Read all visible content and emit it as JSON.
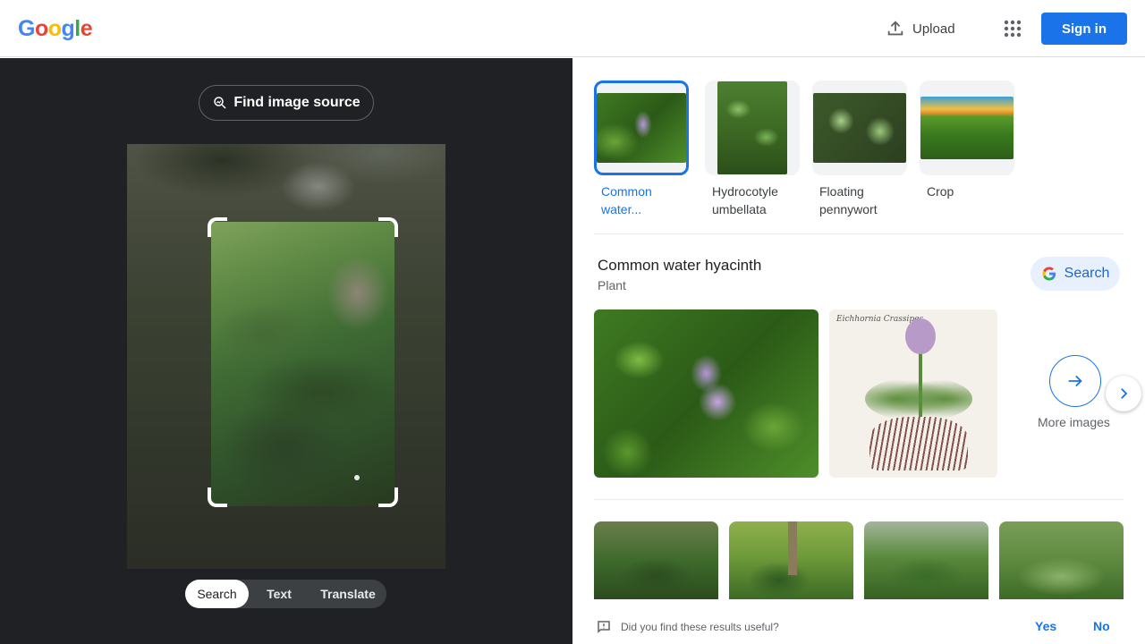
{
  "header": {
    "logo_letters": [
      {
        "ch": "G",
        "color": "#4285F4"
      },
      {
        "ch": "o",
        "color": "#EA4335"
      },
      {
        "ch": "o",
        "color": "#FBBC05"
      },
      {
        "ch": "g",
        "color": "#4285F4"
      },
      {
        "ch": "l",
        "color": "#34A853"
      },
      {
        "ch": "e",
        "color": "#EA4335"
      }
    ],
    "upload_label": "Upload",
    "apps_icon": "grid-dots-icon",
    "signin_label": "Sign in"
  },
  "left_panel": {
    "find_source_label": "Find image source",
    "modes": [
      "Search",
      "Text",
      "Translate"
    ],
    "active_mode": "Search"
  },
  "chips": [
    {
      "label_line1": "Common",
      "label_line2": "water...",
      "selected": true
    },
    {
      "label_line1": "Hydrocotyle",
      "label_line2": "umbellata",
      "selected": false
    },
    {
      "label_line1": "Floating",
      "label_line2": "pennywort",
      "selected": false
    },
    {
      "label_line1": "Crop",
      "label_line2": "",
      "selected": false
    }
  ],
  "entity": {
    "title": "Common water hyacinth",
    "subtitle": "Plant",
    "search_label": "Search",
    "more_images_label": "More images",
    "illustration_signature": "Eichhornia Crassipes"
  },
  "feedback": {
    "question": "Did you find these results useful?",
    "yes": "Yes",
    "no": "No"
  },
  "colors": {
    "accent": "#1a73e8",
    "left_bg": "#202124"
  }
}
